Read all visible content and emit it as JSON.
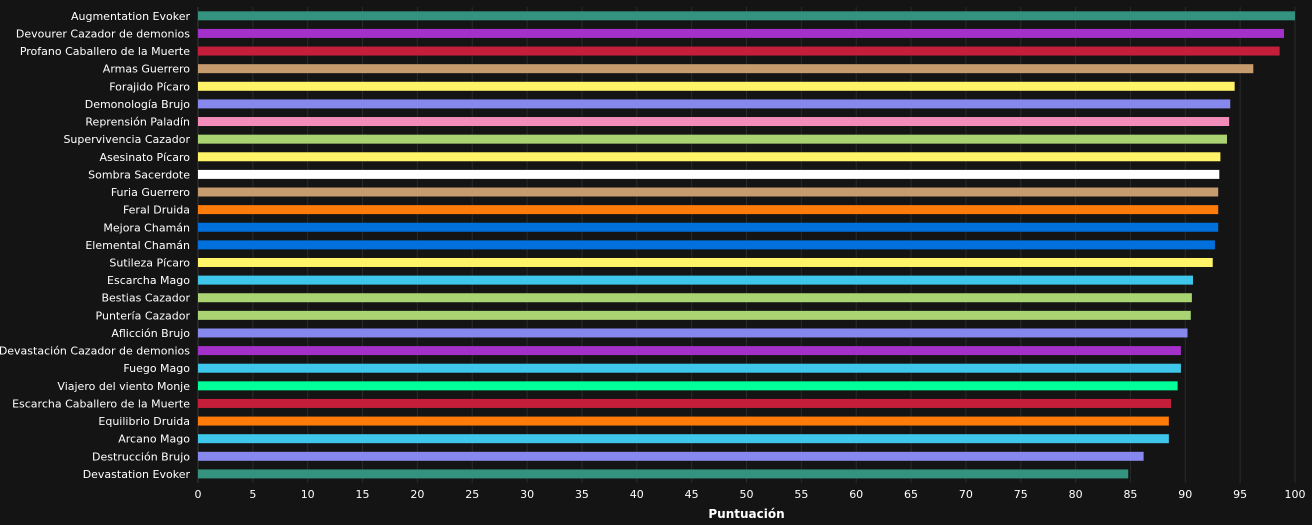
{
  "chart_data": {
    "type": "bar",
    "orientation": "horizontal",
    "xlabel": "Puntuación",
    "xlim": [
      0,
      100
    ],
    "xticks": [
      0,
      5,
      10,
      15,
      20,
      25,
      30,
      35,
      40,
      45,
      50,
      55,
      60,
      65,
      70,
      75,
      80,
      85,
      90,
      95,
      100
    ],
    "grid": true,
    "background": "#141414",
    "categories": [
      "Augmentation Evoker",
      "Devourer Cazador de demonios",
      "Profano Caballero de la Muerte",
      "Armas Guerrero",
      "Forajido Pícaro",
      "Demonología Brujo",
      "Reprensión Paladín",
      "Supervivencia Cazador",
      "Asesinato Pícaro",
      "Sombra Sacerdote",
      "Furia Guerrero",
      "Feral Druida",
      "Mejora Chamán",
      "Elemental Chamán",
      "Sutileza Pícaro",
      "Escarcha Mago",
      "Bestias Cazador",
      "Puntería Cazador",
      "Aflicción Brujo",
      "Devastación Cazador de demonios",
      "Fuego Mago",
      "Viajero del viento Monje",
      "Escarcha Caballero de la Muerte",
      "Equilibrio Druida",
      "Arcano Mago",
      "Destrucción Brujo",
      "Devastation Evoker"
    ],
    "values": [
      100,
      99,
      98.6,
      96.2,
      94.5,
      94.1,
      94.0,
      93.8,
      93.2,
      93.1,
      93.0,
      93.0,
      93.0,
      92.7,
      92.5,
      90.7,
      90.6,
      90.5,
      90.2,
      89.6,
      89.6,
      89.3,
      88.7,
      88.5,
      88.5,
      86.2,
      84.8
    ],
    "colors": [
      "#33937F",
      "#A330C9",
      "#C41E3A",
      "#C69B6D",
      "#FFF468",
      "#8788EE",
      "#F48CBA",
      "#AAD372",
      "#FFF468",
      "#FFFFFF",
      "#C69B6D",
      "#FF7C0A",
      "#0070DD",
      "#0070DD",
      "#FFF468",
      "#3FC7EB",
      "#AAD372",
      "#AAD372",
      "#8788EE",
      "#A330C9",
      "#3FC7EB",
      "#00FF98",
      "#C41E3A",
      "#FF7C0A",
      "#3FC7EB",
      "#8788EE",
      "#33937F"
    ]
  }
}
